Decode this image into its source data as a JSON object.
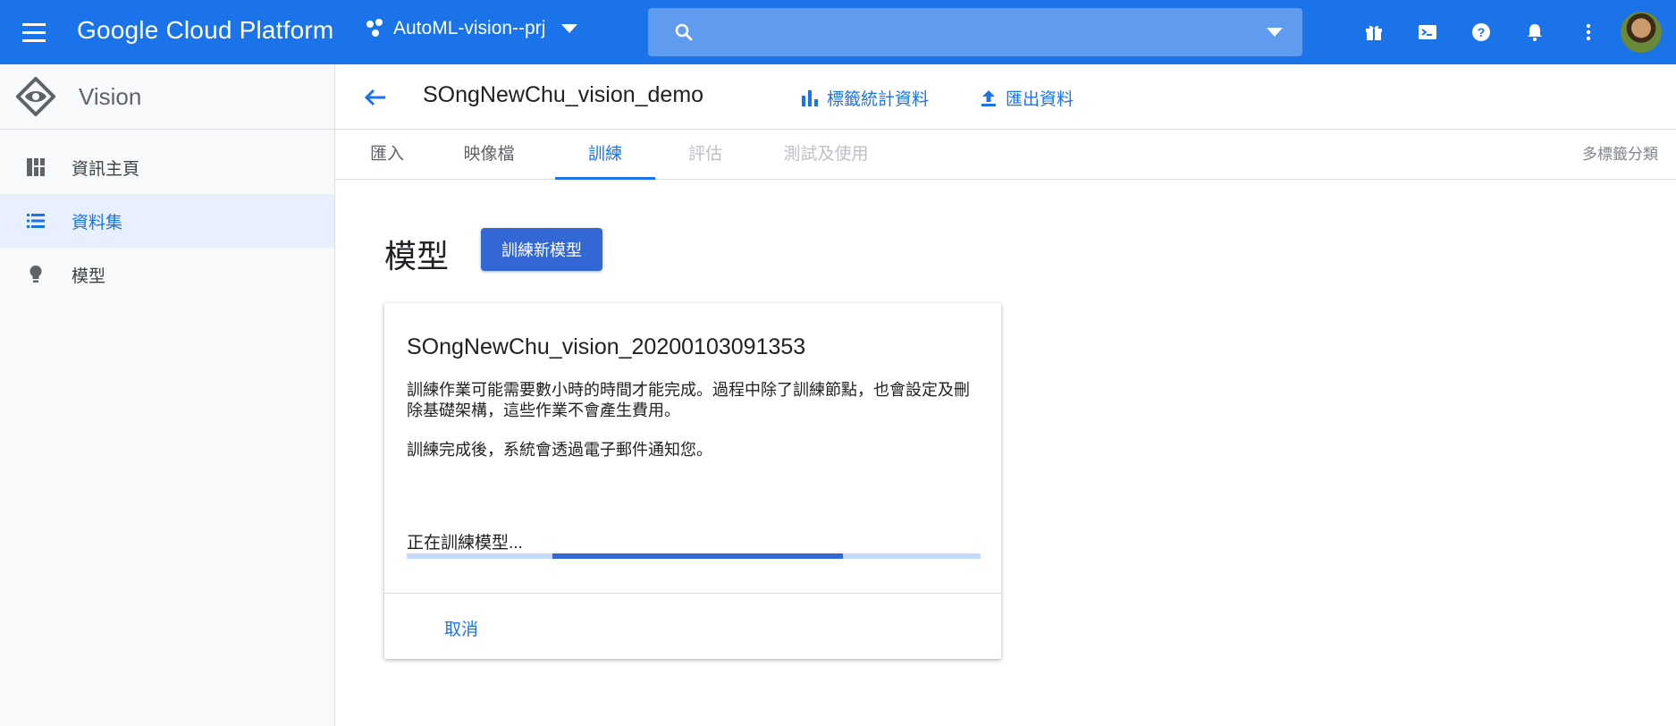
{
  "topbar": {
    "app_title": "Google Cloud Platform",
    "project_name": "AutoML-vision--prj",
    "search_placeholder": "",
    "icons": [
      "gift-icon",
      "terminal-icon",
      "help-icon",
      "notifications-icon",
      "more-vert-icon",
      "avatar"
    ]
  },
  "sidebar": {
    "title": "Vision",
    "items": [
      {
        "label": "資訊主頁",
        "icon": "dashboard-icon",
        "active": false
      },
      {
        "label": "資料集",
        "icon": "list-icon",
        "active": true
      },
      {
        "label": "模型",
        "icon": "lightbulb-icon",
        "active": false
      }
    ]
  },
  "header": {
    "dataset_title": "SOngNewChu_vision_demo",
    "label_stats": "標籤統計資料",
    "export": "匯出資料"
  },
  "tabs": {
    "items": [
      "匯入",
      "映像檔",
      "訓練",
      "評估",
      "測試及使用"
    ],
    "active": "訓練",
    "classification_type": "多標籤分類"
  },
  "content": {
    "heading": "模型",
    "train_button": "訓練新模型"
  },
  "card": {
    "model_name": "SOngNewChu_vision_20200103091353",
    "description": "訓練作業可能需要數小時的時間才能完成。過程中除了訓練節點，也會設定及刪除基礎架構，這些作業不會產生費用。",
    "notice": "訓練完成後，系統會透過電子郵件通知您。",
    "progress_label": "正在訓練模型...",
    "cancel_label": "取消"
  },
  "colors": {
    "brand_blue": "#1a73e8",
    "button_blue": "#3367d6",
    "progress_track": "#c6dafc"
  }
}
